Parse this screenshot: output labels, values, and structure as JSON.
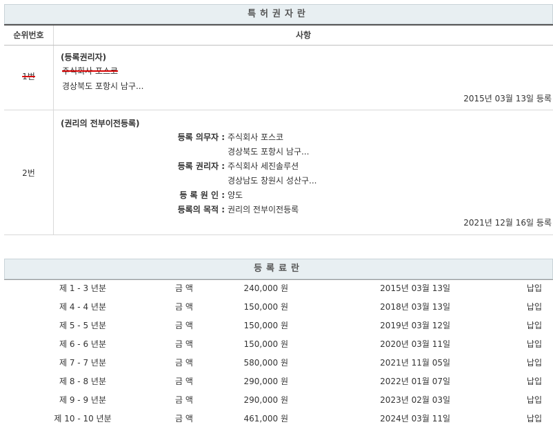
{
  "owner_section": {
    "title": "특허권자란",
    "header": {
      "col_num": "순위번호",
      "col_item": "사항"
    },
    "entries": [
      {
        "num": "1번",
        "heading": "(등록권리자)",
        "name": "주식회사 포스코",
        "address": "경상북도 포항시 남구...",
        "date": "2015년 03월 13일 등록"
      },
      {
        "num": "2번",
        "heading": "(권리의 전부이전등록)",
        "obligor_label": "등록 의무자 :",
        "obligor_name": "주식회사 포스코",
        "obligor_address": "경상북도 포항시 남구...",
        "holder_label": "등록 권리자 :",
        "holder_name": "주식회사 세진솔루션",
        "holder_address": "경상남도 창원시 성산구...",
        "cause_label": "등 록 원 인 :",
        "cause": "양도",
        "purpose_label": "등록의 목적 :",
        "purpose": "권리의 전부이전등록",
        "date": "2021년 12월 16일 등록"
      }
    ]
  },
  "fee_section": {
    "title": "등록료란",
    "rows": [
      {
        "period": "제 1 - 3 년분",
        "amount_label": "금 액",
        "amount": "240,000 원",
        "date": "2015년 03월 13일",
        "status": "납입"
      },
      {
        "period": "제 4 - 4 년분",
        "amount_label": "금 액",
        "amount": "150,000 원",
        "date": "2018년 03월 13일",
        "status": "납입"
      },
      {
        "period": "제 5 - 5 년분",
        "amount_label": "금 액",
        "amount": "150,000 원",
        "date": "2019년 03월 12일",
        "status": "납입"
      },
      {
        "period": "제 6 - 6 년분",
        "amount_label": "금 액",
        "amount": "150,000 원",
        "date": "2020년 03월 11일",
        "status": "납입"
      },
      {
        "period": "제 7 - 7 년분",
        "amount_label": "금 액",
        "amount": "580,000 원",
        "date": "2021년 11월 05일",
        "status": "납입"
      },
      {
        "period": "제 8 - 8 년분",
        "amount_label": "금 액",
        "amount": "290,000 원",
        "date": "2022년 01월 07일",
        "status": "납입"
      },
      {
        "period": "제 9 - 9 년분",
        "amount_label": "금 액",
        "amount": "290,000 원",
        "date": "2023년 02월 03일",
        "status": "납입"
      },
      {
        "period": "제 10 - 10 년분",
        "amount_label": "금 액",
        "amount": "461,000 원",
        "date": "2024년 03월 11일",
        "status": "납입"
      }
    ]
  }
}
